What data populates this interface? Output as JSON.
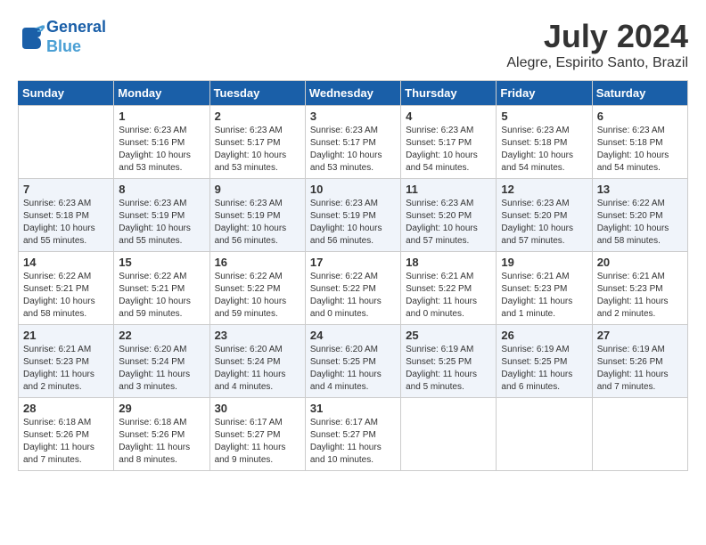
{
  "header": {
    "logo_line1": "General",
    "logo_line2": "Blue",
    "month": "July 2024",
    "location": "Alegre, Espirito Santo, Brazil"
  },
  "days_of_week": [
    "Sunday",
    "Monday",
    "Tuesday",
    "Wednesday",
    "Thursday",
    "Friday",
    "Saturday"
  ],
  "weeks": [
    [
      {
        "day": "",
        "info": ""
      },
      {
        "day": "1",
        "info": "Sunrise: 6:23 AM\nSunset: 5:16 PM\nDaylight: 10 hours\nand 53 minutes."
      },
      {
        "day": "2",
        "info": "Sunrise: 6:23 AM\nSunset: 5:17 PM\nDaylight: 10 hours\nand 53 minutes."
      },
      {
        "day": "3",
        "info": "Sunrise: 6:23 AM\nSunset: 5:17 PM\nDaylight: 10 hours\nand 53 minutes."
      },
      {
        "day": "4",
        "info": "Sunrise: 6:23 AM\nSunset: 5:17 PM\nDaylight: 10 hours\nand 54 minutes."
      },
      {
        "day": "5",
        "info": "Sunrise: 6:23 AM\nSunset: 5:18 PM\nDaylight: 10 hours\nand 54 minutes."
      },
      {
        "day": "6",
        "info": "Sunrise: 6:23 AM\nSunset: 5:18 PM\nDaylight: 10 hours\nand 54 minutes."
      }
    ],
    [
      {
        "day": "7",
        "info": "Sunrise: 6:23 AM\nSunset: 5:18 PM\nDaylight: 10 hours\nand 55 minutes."
      },
      {
        "day": "8",
        "info": "Sunrise: 6:23 AM\nSunset: 5:19 PM\nDaylight: 10 hours\nand 55 minutes."
      },
      {
        "day": "9",
        "info": "Sunrise: 6:23 AM\nSunset: 5:19 PM\nDaylight: 10 hours\nand 56 minutes."
      },
      {
        "day": "10",
        "info": "Sunrise: 6:23 AM\nSunset: 5:19 PM\nDaylight: 10 hours\nand 56 minutes."
      },
      {
        "day": "11",
        "info": "Sunrise: 6:23 AM\nSunset: 5:20 PM\nDaylight: 10 hours\nand 57 minutes."
      },
      {
        "day": "12",
        "info": "Sunrise: 6:23 AM\nSunset: 5:20 PM\nDaylight: 10 hours\nand 57 minutes."
      },
      {
        "day": "13",
        "info": "Sunrise: 6:22 AM\nSunset: 5:20 PM\nDaylight: 10 hours\nand 58 minutes."
      }
    ],
    [
      {
        "day": "14",
        "info": "Sunrise: 6:22 AM\nSunset: 5:21 PM\nDaylight: 10 hours\nand 58 minutes."
      },
      {
        "day": "15",
        "info": "Sunrise: 6:22 AM\nSunset: 5:21 PM\nDaylight: 10 hours\nand 59 minutes."
      },
      {
        "day": "16",
        "info": "Sunrise: 6:22 AM\nSunset: 5:22 PM\nDaylight: 10 hours\nand 59 minutes."
      },
      {
        "day": "17",
        "info": "Sunrise: 6:22 AM\nSunset: 5:22 PM\nDaylight: 11 hours\nand 0 minutes."
      },
      {
        "day": "18",
        "info": "Sunrise: 6:21 AM\nSunset: 5:22 PM\nDaylight: 11 hours\nand 0 minutes."
      },
      {
        "day": "19",
        "info": "Sunrise: 6:21 AM\nSunset: 5:23 PM\nDaylight: 11 hours\nand 1 minute."
      },
      {
        "day": "20",
        "info": "Sunrise: 6:21 AM\nSunset: 5:23 PM\nDaylight: 11 hours\nand 2 minutes."
      }
    ],
    [
      {
        "day": "21",
        "info": "Sunrise: 6:21 AM\nSunset: 5:23 PM\nDaylight: 11 hours\nand 2 minutes."
      },
      {
        "day": "22",
        "info": "Sunrise: 6:20 AM\nSunset: 5:24 PM\nDaylight: 11 hours\nand 3 minutes."
      },
      {
        "day": "23",
        "info": "Sunrise: 6:20 AM\nSunset: 5:24 PM\nDaylight: 11 hours\nand 4 minutes."
      },
      {
        "day": "24",
        "info": "Sunrise: 6:20 AM\nSunset: 5:25 PM\nDaylight: 11 hours\nand 4 minutes."
      },
      {
        "day": "25",
        "info": "Sunrise: 6:19 AM\nSunset: 5:25 PM\nDaylight: 11 hours\nand 5 minutes."
      },
      {
        "day": "26",
        "info": "Sunrise: 6:19 AM\nSunset: 5:25 PM\nDaylight: 11 hours\nand 6 minutes."
      },
      {
        "day": "27",
        "info": "Sunrise: 6:19 AM\nSunset: 5:26 PM\nDaylight: 11 hours\nand 7 minutes."
      }
    ],
    [
      {
        "day": "28",
        "info": "Sunrise: 6:18 AM\nSunset: 5:26 PM\nDaylight: 11 hours\nand 7 minutes."
      },
      {
        "day": "29",
        "info": "Sunrise: 6:18 AM\nSunset: 5:26 PM\nDaylight: 11 hours\nand 8 minutes."
      },
      {
        "day": "30",
        "info": "Sunrise: 6:17 AM\nSunset: 5:27 PM\nDaylight: 11 hours\nand 9 minutes."
      },
      {
        "day": "31",
        "info": "Sunrise: 6:17 AM\nSunset: 5:27 PM\nDaylight: 11 hours\nand 10 minutes."
      },
      {
        "day": "",
        "info": ""
      },
      {
        "day": "",
        "info": ""
      },
      {
        "day": "",
        "info": ""
      }
    ]
  ]
}
